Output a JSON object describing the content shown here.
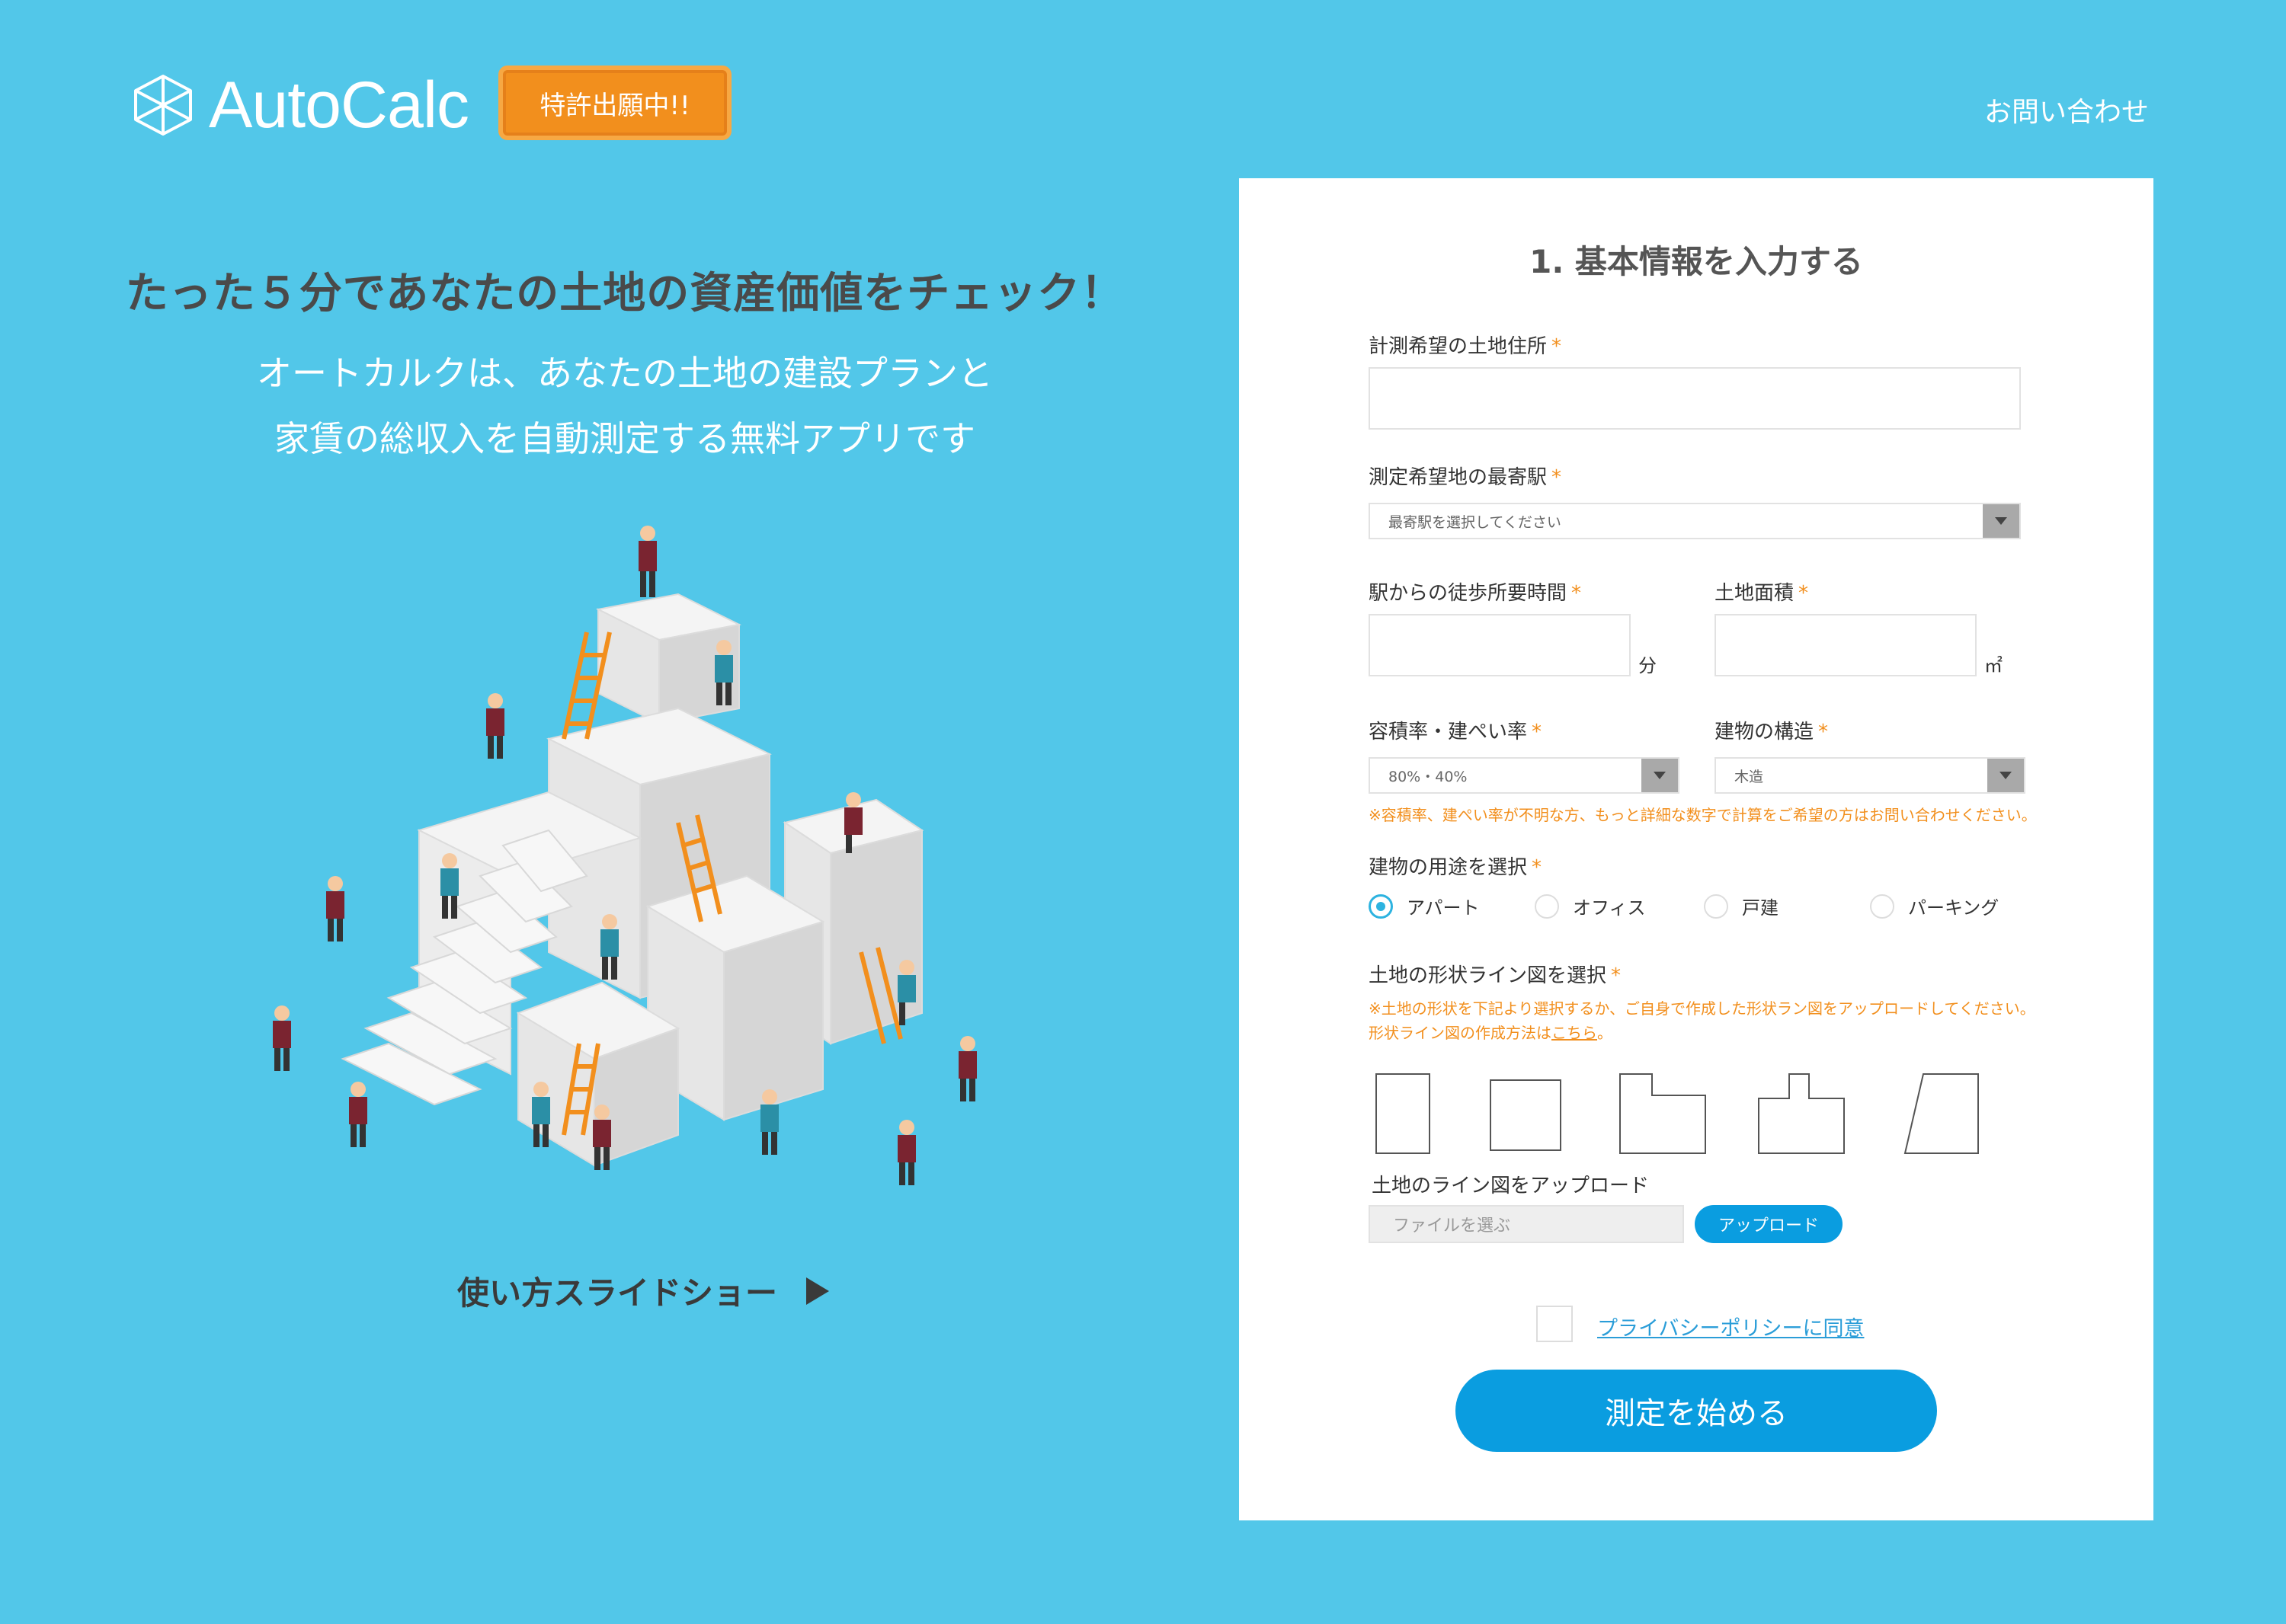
{
  "header": {
    "logo_text": "AutoCalc",
    "badge": "特許出願中!!",
    "contact": "お問い合わせ"
  },
  "hero": {
    "headline": "たった５分であなたの土地の資産価値をチェック！",
    "sub_line1": "オートカルクは、あなたの土地の建設プランと",
    "sub_line2": "家賃の総収入を自動測定する無料アプリです",
    "slideshow_label": "使い方スライドショー"
  },
  "form": {
    "title": "1. 基本情報を入力する",
    "address_label": "計測希望の土地住所",
    "station_label": "測定希望地の最寄駅",
    "station_placeholder": "最寄駅を選択してください",
    "walk_label": "駅からの徒歩所要時間",
    "walk_unit": "分",
    "area_label": "土地面積",
    "area_unit": "㎡",
    "ratio_label": "容積率・建ぺい率",
    "ratio_value": "80%・40%",
    "structure_label": "建物の構造",
    "structure_value": "木造",
    "ratio_note": "※容積率、建ぺい率が不明な方、もっと詳細な数字で計算をご希望の方はお問い合わせください。",
    "usage_label": "建物の用途を選択",
    "usage_options": [
      "アパート",
      "オフィス",
      "戸建",
      "パーキング"
    ],
    "usage_selected": "アパート",
    "shape_label": "土地の形状ライン図を選択",
    "shape_note1": "※土地の形状を下記より選択するか、ご自身で作成した形状ラン図をアップロードしてください。",
    "shape_note2_prefix": "形状ライン図の作成方法は",
    "shape_note2_link": "こちら",
    "shape_note2_suffix": "。",
    "upload_label": "土地のライン図をアップロード",
    "file_placeholder": "ファイルを選ぶ",
    "upload_button": "アップロード",
    "privacy_label": "プライバシーポリシーに同意",
    "submit_label": "測定を始める"
  },
  "colors": {
    "background": "#52c7e9",
    "accent_orange": "#f28f1d",
    "button_blue": "#0a9de0"
  }
}
